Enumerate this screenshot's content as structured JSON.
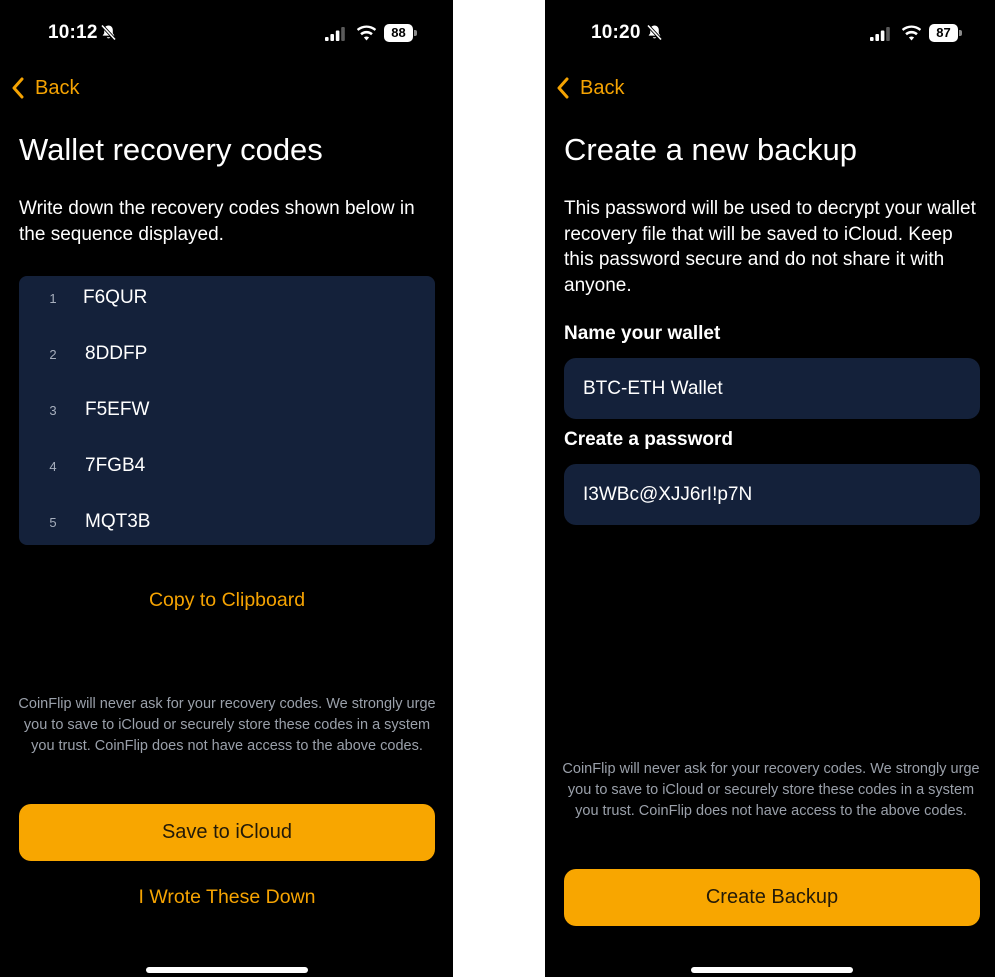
{
  "left_screen": {
    "status": {
      "time": "10:12",
      "battery": "88"
    },
    "back_label": "Back",
    "title": "Wallet recovery codes",
    "description": "Write down the recovery codes shown below in the sequence displayed.",
    "codes": [
      {
        "index": "1",
        "code": "F6QUR"
      },
      {
        "index": "2",
        "code": "8DDFP"
      },
      {
        "index": "3",
        "code": "F5EFW"
      },
      {
        "index": "4",
        "code": "7FGB4"
      },
      {
        "index": "5",
        "code": "MQT3B"
      }
    ],
    "copy_label": "Copy to Clipboard",
    "note": "CoinFlip will never ask for your recovery codes. We strongly urge you to save to iCloud or securely store these codes in a system you trust. CoinFlip does not have access to the above codes.",
    "save_label": "Save to iCloud",
    "wrote_label": "I Wrote These Down"
  },
  "right_screen": {
    "status": {
      "time": "10:20",
      "battery": "87"
    },
    "back_label": "Back",
    "title": "Create a new backup",
    "description": "This password will be used to decrypt your wallet recovery file that will be saved to iCloud. Keep this password secure and do not share it with anyone.",
    "wallet_name_label": "Name your wallet",
    "wallet_name_value": "BTC-ETH Wallet",
    "password_label": "Create a password",
    "password_value": "I3WBc@XJJ6rI!p7N",
    "note": "CoinFlip will never ask for your recovery codes. We strongly urge you to save to iCloud or securely store these codes in a system you trust. CoinFlip does not have access to the above codes.",
    "create_label": "Create Backup"
  },
  "colors": {
    "background": "#000000",
    "accent": "#f5a302",
    "button": "#f8a600",
    "card": "#14213a",
    "note_text": "#9aa0aa"
  },
  "icons": [
    "bell-slash-icon",
    "cellular-signal-icon",
    "wifi-icon",
    "battery-icon",
    "chevron-left-icon"
  ]
}
